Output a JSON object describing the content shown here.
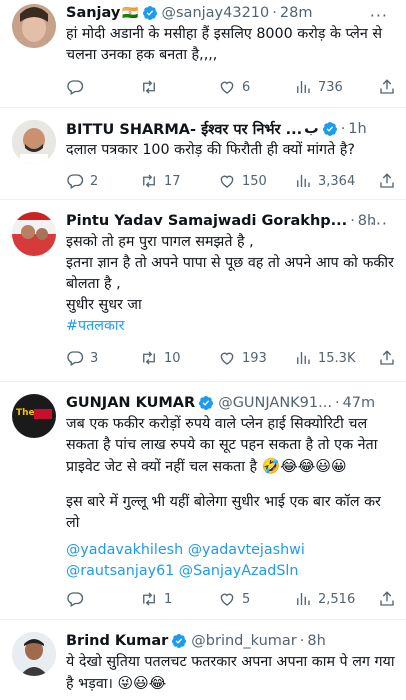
{
  "tweets": [
    {
      "name": "Sanjay",
      "flag": "🇮🇳",
      "handle": "@sanjay43210",
      "time": "28m",
      "text": "हां मोदी अडानी के मसीहा हैं इसलिए 8000 करोड़ के प्लेन से चलना उनका हक बनता है,,,,",
      "reply": "",
      "retweet": "",
      "like": "6",
      "views": "736"
    },
    {
      "name": "BITTU SHARMA- ईश्वर पर निर्भर ...",
      "name_suffix": "ب",
      "handle": "",
      "time": "1h",
      "text": "दलाल पत्रकार 100 करोड़ की फिरौती ही क्यों मांगते है?",
      "reply": "2",
      "retweet": "17",
      "like": "150",
      "views": "3,364"
    },
    {
      "name": "Pintu Yadav Samajwadi Gorakhp...",
      "handle": "",
      "time": "8h",
      "text": "इसको तो हम पुरा पागल समझते है ,\nइतना ज्ञान है तो अपने पापा से पूछ वह तो अपने आप को फकीर बोलता है ,\nसुधीर सुधर जा",
      "hashtag": "#पतलकार",
      "reply": "3",
      "retweet": "10",
      "like": "193",
      "views": "15.3K"
    },
    {
      "name": "GUNJAN KUMAR",
      "handle": "@GUNJANK91...",
      "time": "47m",
      "avatar_text": "The",
      "text": "जब एक फकीर करोड़ों रुपये वाले प्लेन हाई सिक्योरिटी चल सकता है पांच लाख रुपये का सूट पहन सकता है तो एक नेता प्राइवेट जेट से क्यों नहीं चल सकता है",
      "emojis": "🤣😂😂😃😀",
      "text2": "इस बारे में गुल्लू भी यहीं बोलेगा सुधीर भाई एक बार कॉल कर लो",
      "mentions1": "@yadavakhilesh @yadavtejashwi",
      "mentions2": "@rautsanjay61 @SanjayAzadSln",
      "reply": "",
      "retweet": "1",
      "like": "5",
      "views": "2,516"
    },
    {
      "name": "Brind Kumar",
      "handle": "@brind_kumar",
      "time": "8h",
      "text": "ये देखो सुतिया पतलचट फतरकार अपना अपना काम पे लग गया है भड़वा।",
      "emojis": "😜😃😂"
    }
  ],
  "colors": {
    "accent": "#1d9bf0",
    "muted": "#536471",
    "text": "#0f1419"
  },
  "icons": [
    "reply-icon",
    "retweet-icon",
    "like-icon",
    "views-icon",
    "share-icon",
    "verified-badge-icon",
    "more-icon"
  ]
}
